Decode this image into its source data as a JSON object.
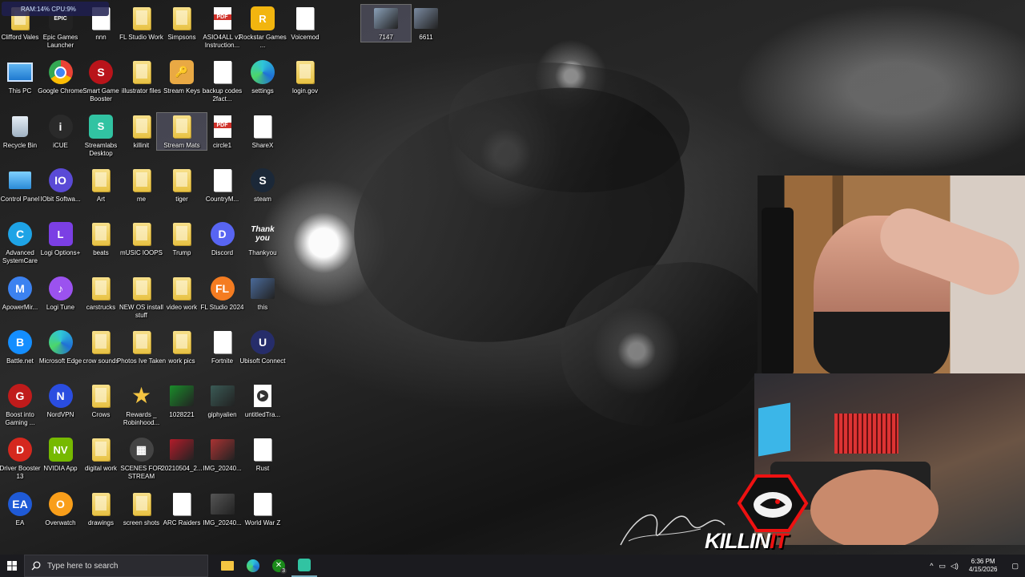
{
  "system_stats": "RAM:14%   CPU:9%",
  "desktop_icons": [
    {
      "label": "Clifford Vales",
      "kind": "folder"
    },
    {
      "label": "This PC",
      "kind": "pc"
    },
    {
      "label": "Recycle Bin",
      "kind": "bin"
    },
    {
      "label": "Control Panel",
      "kind": "control"
    },
    {
      "label": "Advanced SystemCare",
      "kind": "app",
      "color": "#1ea3e6",
      "glyph": "C"
    },
    {
      "label": "ApowerMir...",
      "kind": "app",
      "color": "#3c82f0",
      "glyph": "M"
    },
    {
      "label": "Battle.net",
      "kind": "app",
      "color": "#148eff",
      "glyph": "B"
    },
    {
      "label": "Boost into Gaming ...",
      "kind": "app",
      "color": "#c01b1b",
      "glyph": "G"
    },
    {
      "label": "Driver Booster 13",
      "kind": "app",
      "color": "#d5281e",
      "glyph": "D"
    },
    {
      "label": "EA",
      "kind": "app",
      "color": "#1f5ad6",
      "glyph": "EA"
    },
    {
      "label": "Epic Games Launcher",
      "kind": "square",
      "color": "#222",
      "glyph": "EPIC"
    },
    {
      "label": "Google Chrome",
      "kind": "chrome"
    },
    {
      "label": "iCUE",
      "kind": "app",
      "color": "#2a2a2a",
      "glyph": "i"
    },
    {
      "label": "IObit Softwa...",
      "kind": "app",
      "color": "#5a4ad6",
      "glyph": "IO"
    },
    {
      "label": "Logi Options+",
      "kind": "square",
      "color": "#7b3fe4",
      "glyph": "L"
    },
    {
      "label": "Logi Tune",
      "kind": "app",
      "color": "#9b52ef",
      "glyph": "♪"
    },
    {
      "label": "Microsoft Edge",
      "kind": "edge"
    },
    {
      "label": "NordVPN",
      "kind": "app",
      "color": "#2a4de0",
      "glyph": "N"
    },
    {
      "label": "NVIDIA App",
      "kind": "square",
      "color": "#76b900",
      "glyph": "NV"
    },
    {
      "label": "Overwatch",
      "kind": "app",
      "color": "#f99e1a",
      "glyph": "O"
    },
    {
      "label": "nnn",
      "kind": "doc"
    },
    {
      "label": "Smart Game Booster",
      "kind": "app",
      "color": "#b9141a",
      "glyph": "S"
    },
    {
      "label": "Streamlabs Desktop",
      "kind": "square",
      "color": "#31c3a2",
      "glyph": "S"
    },
    {
      "label": "Art",
      "kind": "folder"
    },
    {
      "label": "beats",
      "kind": "folder"
    },
    {
      "label": "carstrucks",
      "kind": "folder"
    },
    {
      "label": "crow sounds",
      "kind": "folder"
    },
    {
      "label": "Crows",
      "kind": "folder"
    },
    {
      "label": "digital work",
      "kind": "folder"
    },
    {
      "label": "drawings",
      "kind": "folder"
    },
    {
      "label": "FL Studio Work",
      "kind": "folder"
    },
    {
      "label": "illustrator files",
      "kind": "folder"
    },
    {
      "label": "killinit",
      "kind": "folder"
    },
    {
      "label": "me",
      "kind": "folder"
    },
    {
      "label": "mUSIC lOOPS",
      "kind": "folder"
    },
    {
      "label": "NEW OS install stuff",
      "kind": "folder"
    },
    {
      "label": "Photos Ive Taken",
      "kind": "folder"
    },
    {
      "label": "Rewards _ Robinhood...",
      "kind": "star"
    },
    {
      "label": "SCENES FOR STREAM",
      "kind": "app",
      "color": "#444",
      "glyph": "▦"
    },
    {
      "label": "screen shots",
      "kind": "folder"
    },
    {
      "label": "Simpsons",
      "kind": "folder"
    },
    {
      "label": "Stream Keys",
      "kind": "square",
      "color": "#e9a944",
      "glyph": "🔑"
    },
    {
      "label": "Stream Mats",
      "kind": "folder",
      "selected": true
    },
    {
      "label": "tiger",
      "kind": "folder"
    },
    {
      "label": "Trump",
      "kind": "folder"
    },
    {
      "label": "video work",
      "kind": "folder"
    },
    {
      "label": "work pics",
      "kind": "folder"
    },
    {
      "label": "1028221",
      "kind": "thumb",
      "color": "#1a8c2a"
    },
    {
      "label": "20210504_2...",
      "kind": "thumb",
      "color": "#b31c2a"
    },
    {
      "label": "ARC Raiders",
      "kind": "doc"
    },
    {
      "label": "ASIO4ALL v2 Instruction...",
      "kind": "pdf"
    },
    {
      "label": "backup codes 2fact...",
      "kind": "doc"
    },
    {
      "label": "circle1",
      "kind": "pdf"
    },
    {
      "label": "CountryM...",
      "kind": "doc"
    },
    {
      "label": "Discord",
      "kind": "app",
      "color": "#5865f2",
      "glyph": "D"
    },
    {
      "label": "FL Studio 2024",
      "kind": "app",
      "color": "#f47c21",
      "glyph": "FL"
    },
    {
      "label": "Fortnite",
      "kind": "doc"
    },
    {
      "label": "giphyalien",
      "kind": "thumb",
      "color": "#3a5a55"
    },
    {
      "label": "IMG_20240...",
      "kind": "thumb",
      "color": "#a33"
    },
    {
      "label": "IMG_20240...",
      "kind": "thumb",
      "color": "#555"
    },
    {
      "label": "Rockstar Games ...",
      "kind": "square",
      "color": "#f2b50f",
      "glyph": "R"
    },
    {
      "label": "settings",
      "kind": "edge"
    },
    {
      "label": "ShareX",
      "kind": "doc"
    },
    {
      "label": "steam",
      "kind": "app",
      "color": "#1b2838",
      "glyph": "S"
    },
    {
      "label": "Thankyou",
      "kind": "thankyou"
    },
    {
      "label": "this",
      "kind": "thumb",
      "color": "#4a6a9a"
    },
    {
      "label": "Ubisoft Connect",
      "kind": "app",
      "color": "#262d6a",
      "glyph": "U"
    },
    {
      "label": "untitledTra...",
      "kind": "play"
    },
    {
      "label": "Rust",
      "kind": "doc"
    },
    {
      "label": "World War Z",
      "kind": "doc"
    },
    {
      "label": "Voicemod",
      "kind": "doc"
    },
    {
      "label": "login.gov",
      "kind": "folder"
    },
    {
      "label": "7147",
      "kind": "thumb",
      "color": "#8aa0b8",
      "selected": true
    },
    {
      "label": "6611",
      "kind": "thumb",
      "color": "#7a8aa0"
    }
  ],
  "overlay": {
    "brand_text_a": "KILLIN",
    "brand_text_b": "IT"
  },
  "taskbar": {
    "search_placeholder": "Type here to search",
    "xbox_badge": "3",
    "time": "6:36 PM",
    "date": "4/15/2026"
  },
  "colors": {
    "taskbar_bg": "#1b1b1f",
    "brand_red": "#e11111"
  }
}
